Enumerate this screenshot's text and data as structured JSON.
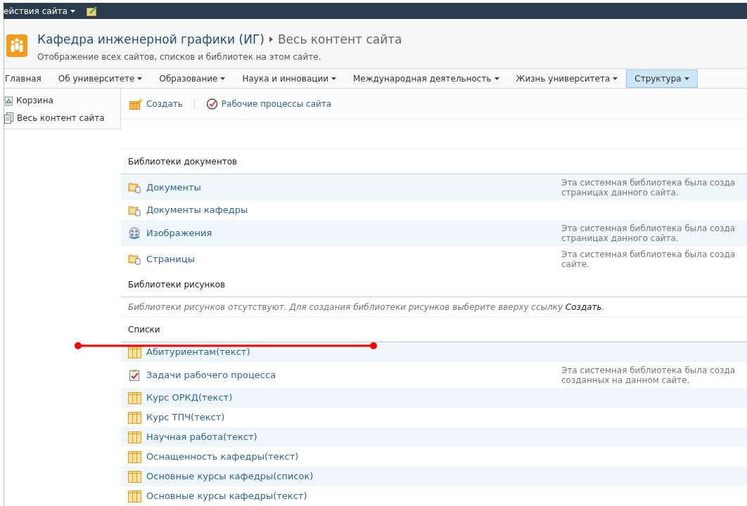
{
  "top_bar": {
    "menu_label": "ействия сайта"
  },
  "header": {
    "site_title": "Кафедра инженерной графики (ИГ)",
    "page_title": "Весь контент сайта",
    "description": "Отображение всех сайтов, списков и библиотек на этом сайте."
  },
  "nav": [
    {
      "label": "Главная",
      "has_menu": false,
      "selected": false
    },
    {
      "label": "Об университете",
      "has_menu": true,
      "selected": false
    },
    {
      "label": "Образование",
      "has_menu": true,
      "selected": false
    },
    {
      "label": "Наука и инновации",
      "has_menu": true,
      "selected": false
    },
    {
      "label": "Международная деятельность",
      "has_menu": true,
      "selected": false
    },
    {
      "label": "Жизнь университета",
      "has_menu": true,
      "selected": false
    },
    {
      "label": "Структура",
      "has_menu": true,
      "selected": true
    }
  ],
  "sidebar": {
    "items": [
      {
        "label": "Корзина",
        "kind": "recycle"
      },
      {
        "label": "Весь контент сайта",
        "kind": "pages"
      }
    ]
  },
  "toolbar": [
    {
      "label": "Создать",
      "kind": "create"
    },
    {
      "label": "Рабочие процессы сайта",
      "kind": "workflow"
    }
  ],
  "sections": [
    {
      "title": "Библиотеки документов",
      "items": [
        {
          "name": "Документы",
          "kind": "document-library",
          "description": [
            "Эта системная библиотека была созда",
            "страницах данного сайта."
          ]
        },
        {
          "name": "Документы кафедры",
          "kind": "document-library"
        },
        {
          "name": "Изображения",
          "kind": "picture-library",
          "description": [
            "Эта системная библиотека была созда",
            "страницах данного сайта."
          ]
        },
        {
          "name": "Страницы",
          "kind": "document-library",
          "description": [
            "Эта системная библиотека была созда",
            "сайте."
          ]
        }
      ]
    },
    {
      "title": "Библиотеки рисунков",
      "empty_message": {
        "text": "Библиотеки рисунков отсутствуют. Для создания библиотеки рисунков выберите вверху ссылку",
        "link": "Создать",
        "end": "."
      }
    },
    {
      "title": "Списки",
      "items": [
        {
          "name": "Абитуриентам(текст)",
          "kind": "list"
        },
        {
          "name": "Задачи рабочего процесса",
          "kind": "tasks",
          "description": [
            "Эта системная библиотека была созда",
            "созданных на данном сайте."
          ]
        },
        {
          "name": "Курс ОРКД(текст)",
          "kind": "list"
        },
        {
          "name": "Курс ТПЧ(текст)",
          "kind": "list"
        },
        {
          "name": "Научная работа(текст)",
          "kind": "list"
        },
        {
          "name": "Оснащенность кафедры(текст)",
          "kind": "list"
        },
        {
          "name": "Основные курсы кафедры(список)",
          "kind": "list"
        },
        {
          "name": "Основные курсы кафедры(текст)",
          "kind": "list"
        }
      ]
    }
  ]
}
